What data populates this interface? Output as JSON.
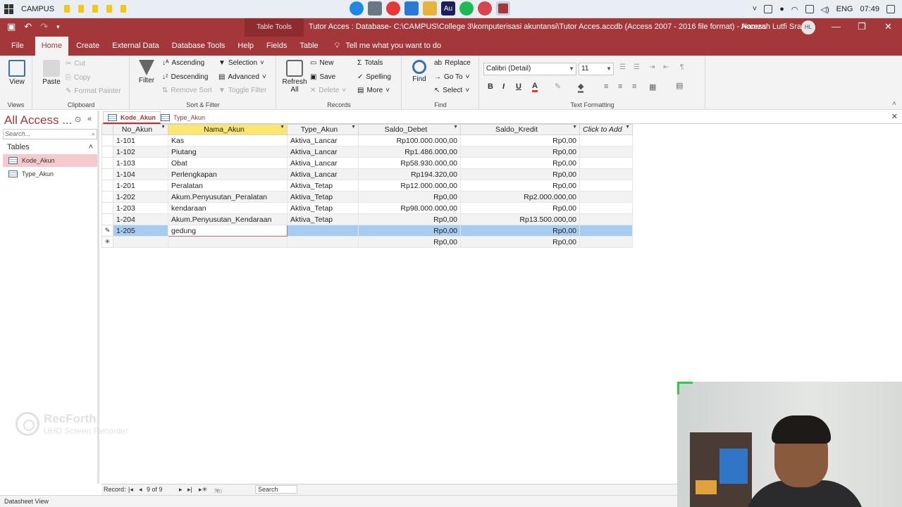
{
  "taskbar": {
    "title": "CAMPUS",
    "language": "ENG",
    "time": "07:49"
  },
  "window": {
    "context_tab": "Table Tools",
    "title": "Tutor Acces : Database- C:\\CAMPUS\\College 3\\komputerisasi akuntansi\\Tutor Acces.accdb (Access 2007 - 2016 file format)  -  Access",
    "user": "Hamzah Lutfi Sra",
    "avatar_initials": "HL"
  },
  "ribbon_tabs": [
    "File",
    "Home",
    "Create",
    "External Data",
    "Database Tools",
    "Help",
    "Fields",
    "Table"
  ],
  "tell_me": "Tell me what you want to do",
  "ribbon": {
    "views": {
      "view": "View",
      "label": "Views"
    },
    "clipboard": {
      "paste": "Paste",
      "cut": "Cut",
      "copy": "Copy",
      "format_painter": "Format Painter",
      "label": "Clipboard"
    },
    "sort_filter": {
      "filter": "Filter",
      "ascending": "Ascending",
      "descending": "Descending",
      "remove_sort": "Remove Sort",
      "selection": "Selection",
      "advanced": "Advanced",
      "toggle_filter": "Toggle Filter",
      "label": "Sort & Filter"
    },
    "records": {
      "refresh": "Refresh",
      "refresh2": "All",
      "new": "New",
      "save": "Save",
      "delete": "Delete",
      "totals": "Totals",
      "spelling": "Spelling",
      "more": "More",
      "label": "Records"
    },
    "find": {
      "find": "Find",
      "replace": "Replace",
      "goto": "Go To",
      "select": "Select",
      "label": "Find"
    },
    "text_formatting": {
      "font": "Calibri (Detail)",
      "size": "11",
      "label": "Text Formatting"
    }
  },
  "nav_pane": {
    "title": "All Access ...",
    "search_placeholder": "Search...",
    "section": "Tables",
    "items": [
      "Kode_Akun",
      "Type_Akun"
    ]
  },
  "doc_tabs": [
    "Kode_Akun",
    "Type_Akun"
  ],
  "table": {
    "columns": [
      "No_Akun",
      "Nama_Akun",
      "Type_Akun",
      "Saldo_Debet",
      "Saldo_Kredit",
      "Click to Add"
    ],
    "rows": [
      [
        "1-101",
        "Kas",
        "Aktiva_Lancar",
        "Rp100.000.000,00",
        "Rp0,00"
      ],
      [
        "1-102",
        "Piutang",
        "Aktiva_Lancar",
        "Rp1.486.000,00",
        "Rp0,00"
      ],
      [
        "1-103",
        "Obat",
        "Aktiva_Lancar",
        "Rp58.930.000,00",
        "Rp0,00"
      ],
      [
        "1-104",
        "Perlengkapan",
        "Aktiva_Lancar",
        "Rp194.320,00",
        "Rp0,00"
      ],
      [
        "1-201",
        "Peralatan",
        "Aktiva_Tetap",
        "Rp12.000.000,00",
        "Rp0,00"
      ],
      [
        "1-202",
        "Akum.Penyusutan_Peralatan",
        "Aktiva_Tetap",
        "Rp0,00",
        "Rp2.000.000,00"
      ],
      [
        "1-203",
        "kendaraan",
        "Aktiva_Tetap",
        "Rp98.000.000,00",
        "Rp0,00"
      ],
      [
        "1-204",
        "Akum.Penyusutan_Kendaraan",
        "Aktiva_Tetap",
        "Rp0,00",
        "Rp13.500.000,00"
      ],
      [
        "1-205",
        "gedung",
        "",
        "Rp0,00",
        "Rp0,00"
      ]
    ],
    "new_row": [
      "",
      "",
      "",
      "Rp0,00",
      "Rp0,00"
    ]
  },
  "record_bar": {
    "label": "Record:",
    "position": "9 of 9",
    "filter": "No Filter",
    "search": "Search"
  },
  "status": "Datasheet View",
  "watermark": {
    "title": "RecForth",
    "subtitle": "UHD Screen Recorder"
  }
}
